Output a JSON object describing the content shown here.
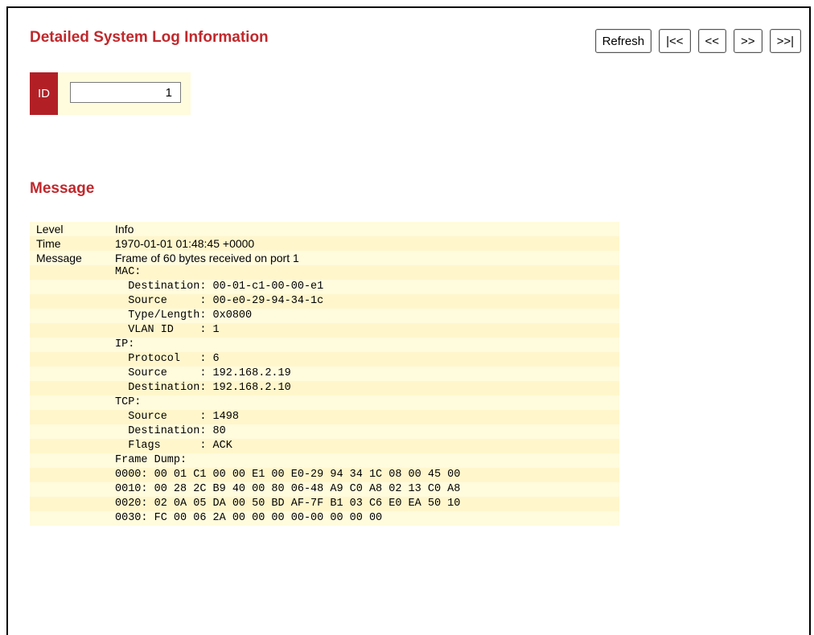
{
  "header": {
    "title": "Detailed System Log Information",
    "buttons": {
      "refresh": "Refresh",
      "first": "|<<",
      "prev": "<<",
      "next": ">>",
      "last": ">>|"
    }
  },
  "id_field": {
    "label": "ID",
    "value": "1"
  },
  "message_section": {
    "title": "Message",
    "rows": [
      {
        "key": "Level",
        "value": "Info"
      },
      {
        "key": "Time",
        "value": "1970-01-01 01:48:45 +0000"
      },
      {
        "key": "Message",
        "value": "Frame of 60 bytes received on port 1"
      }
    ],
    "detail_lines": [
      "MAC:",
      "  Destination: 00-01-c1-00-00-e1",
      "  Source     : 00-e0-29-94-34-1c",
      "  Type/Length: 0x0800",
      "  VLAN ID    : 1",
      "IP:",
      "  Protocol   : 6",
      "  Source     : 192.168.2.19",
      "  Destination: 192.168.2.10",
      "TCP:",
      "  Source     : 1498",
      "  Destination: 80",
      "  Flags      : ACK",
      "Frame Dump:",
      "0000: 00 01 C1 00 00 E1 00 E0-29 94 34 1C 08 00 45 00",
      "0010: 00 28 2C B9 40 00 80 06-48 A9 C0 A8 02 13 C0 A8",
      "0020: 02 0A 05 DA 00 50 BD AF-7F B1 03 C6 E0 EA 50 10",
      "0030: FC 00 06 2A 00 00 00 00-00 00 00 00"
    ]
  }
}
